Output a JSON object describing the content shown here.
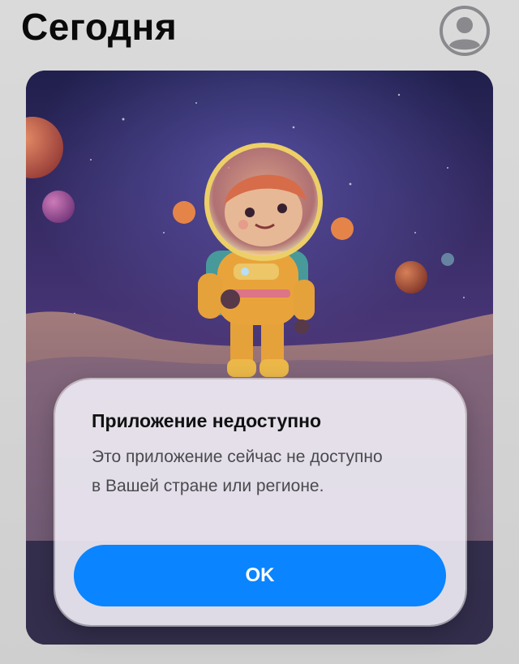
{
  "header": {
    "title": "Сегодня",
    "account_icon": "person-circle-icon"
  },
  "card": {
    "artwork": "astronaut-on-planet-illustration"
  },
  "alert": {
    "title": "Приложение недоступно",
    "message": "Это приложение сейчас не доступно в Вашей стране или регионе.",
    "ok_label": "OK"
  },
  "colors": {
    "accent": "#0a84ff",
    "background": "#d8d8d8",
    "alert_background": "#ece8f2",
    "title_text": "#0a0a0a",
    "message_text": "#4a4a4e"
  }
}
